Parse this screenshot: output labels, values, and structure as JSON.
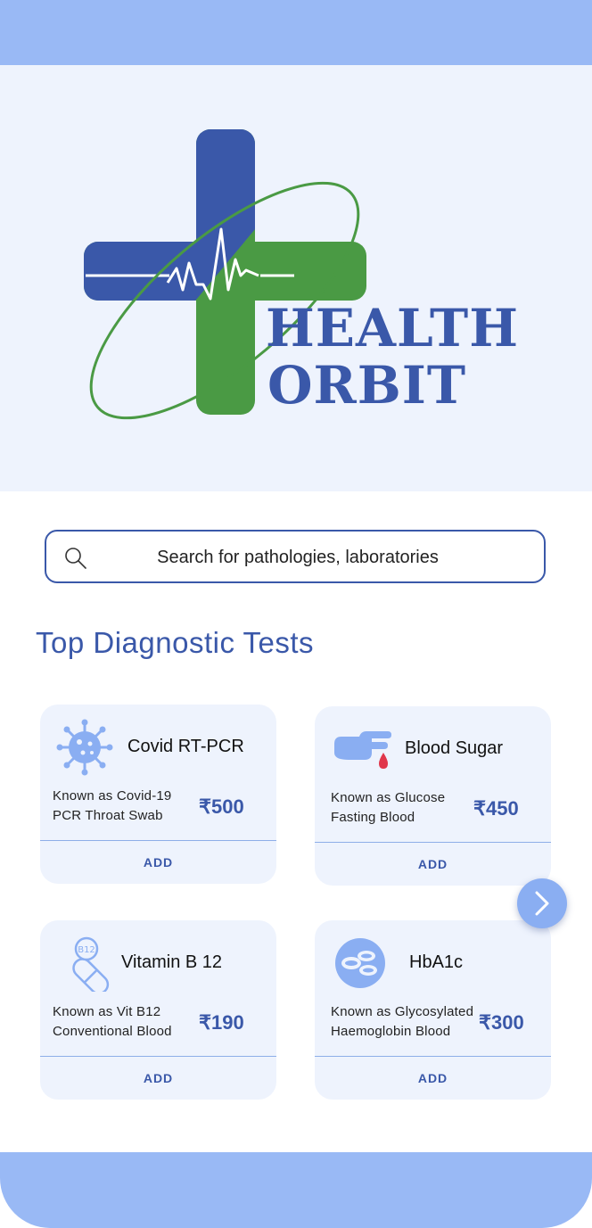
{
  "brand": {
    "line1": "HEALTH",
    "line2": "ORBIT"
  },
  "search": {
    "placeholder": "Search for pathologies, laboratories"
  },
  "section": {
    "title": "Top Diagnostic Tests"
  },
  "colors": {
    "primary": "#3a58a9",
    "accent_green": "#4a9a44",
    "light_blue": "#99b9f5",
    "card_bg": "#eef3fd"
  },
  "tests": [
    {
      "name": "Covid RT-PCR",
      "desc1": "Known as Covid-19",
      "desc2": "PCR Throat Swab",
      "price": "₹500",
      "add": "ADD",
      "icon": "virus-icon"
    },
    {
      "name": "Blood Sugar",
      "desc1": "Known as Glucose",
      "desc2": "Fasting Blood",
      "price": "₹450",
      "add": "ADD",
      "icon": "finger-blood-drop-icon"
    },
    {
      "name": "Vitamin B 12",
      "desc1": "Known as Vit B12",
      "desc2": "Conventional Blood",
      "price": "₹190",
      "add": "ADD",
      "icon": "vitamin-capsule-icon"
    },
    {
      "name": "HbA1c",
      "desc1": "Known as Glycosylated",
      "desc2": "Haemoglobin Blood",
      "price": "₹300",
      "add": "ADD",
      "icon": "blood-cells-icon"
    }
  ],
  "b12_badge": "B12"
}
